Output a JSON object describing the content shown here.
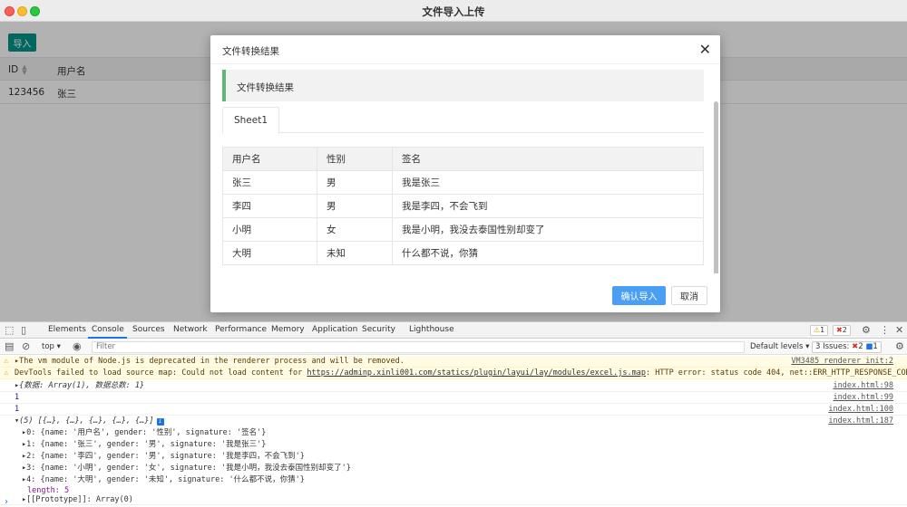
{
  "window": {
    "title": "文件导入上传"
  },
  "page": {
    "import_button": "导入",
    "table": {
      "headers": [
        "ID",
        "用户名"
      ],
      "rows": [
        [
          "123456",
          "张三"
        ]
      ]
    }
  },
  "modal": {
    "title": "文件转换结果",
    "close_glyph": "✕",
    "quote": "文件转换结果",
    "tab": "Sheet1",
    "table": {
      "headers": [
        "用户名",
        "性别",
        "签名"
      ],
      "rows": [
        [
          "张三",
          "男",
          "我是张三"
        ],
        [
          "李四",
          "男",
          "我是李四，不会飞到"
        ],
        [
          "小明",
          "女",
          "我是小明，我没去泰国性别却变了"
        ],
        [
          "大明",
          "未知",
          "什么都不说，你猜"
        ]
      ]
    },
    "confirm": "确认导入",
    "cancel": "取消"
  },
  "devtools": {
    "tabs": [
      "Elements",
      "Console",
      "Sources",
      "Network",
      "Performance",
      "Memory",
      "Application",
      "Security",
      "Lighthouse"
    ],
    "warn_count": "1",
    "error_count": "2",
    "context": "top",
    "filter_placeholder": "Filter",
    "levels": "Default levels",
    "issues": {
      "label": "3 Issues:",
      "errors": "2",
      "info": "1"
    },
    "console": {
      "warn1": {
        "text": "▸The vm module of Node.js is deprecated in the renderer process and will be removed.",
        "source": "VM3485 renderer_init:2"
      },
      "warn2": {
        "prefix": "DevTools failed to load source map: Could not load content for ",
        "url": "https://adminp.xinli001.com/statics/plugin/layui/lay/modules/excel.js.map",
        "suffix": ": HTTP error: status code 404, net::ERR_HTTP_RESPONSE_CODE_FAILURE"
      },
      "log1": {
        "text": "▸{数据: Array(1), 数据总数: 1}",
        "source": "index.html:98"
      },
      "log2": {
        "text": "1",
        "source": "index.html:99"
      },
      "log3": {
        "text": "1",
        "source": "index.html:100"
      },
      "array_head": {
        "text": "▾(5) [{…}, {…}, {…}, {…}, {…}]",
        "source": "index.html:187"
      },
      "items": [
        "▸0: {name: '用户名', gender: '性别', signature: '签名'}",
        "▸1: {name: '张三', gender: '男', signature: '我是张三'}",
        "▸2: {name: '李四', gender: '男', signature: '我是李四，不会飞到'}",
        "▸3: {name: '小明', gender: '女', signature: '我是小明，我没去泰国性别却变了'}",
        "▸4: {name: '大明', gender: '未知', signature: '什么都不说，你猜'}"
      ],
      "length": "length: 5",
      "prototype": "▸[[Prototype]]: Array(0)",
      "prompt": "›"
    }
  }
}
